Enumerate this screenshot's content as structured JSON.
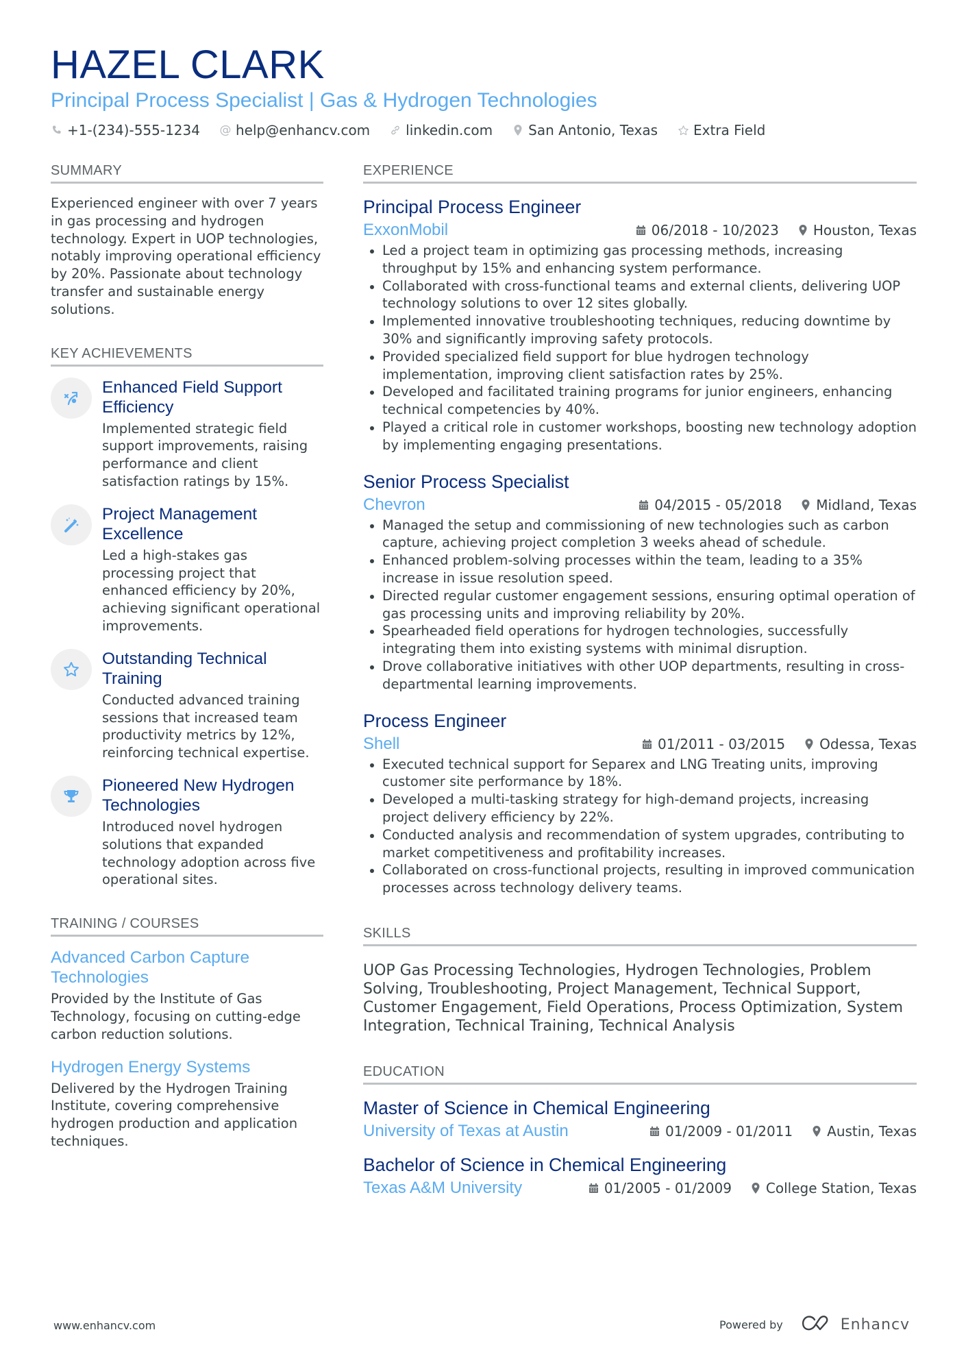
{
  "header": {
    "name": "HAZEL CLARK",
    "title": "Principal Process Specialist | Gas & Hydrogen Technologies",
    "contacts": [
      {
        "icon": "phone-icon",
        "text": "+1-(234)-555-1234"
      },
      {
        "icon": "at-icon",
        "text": "help@enhancv.com"
      },
      {
        "icon": "link-icon",
        "text": "linkedin.com"
      },
      {
        "icon": "location-icon",
        "text": "San Antonio, Texas"
      },
      {
        "icon": "star-icon",
        "text": "Extra Field"
      }
    ]
  },
  "summary": {
    "heading": "SUMMARY",
    "text": "Experienced engineer with over 7 years in gas processing and hydrogen technology. Expert in UOP technologies, notably improving operational efficiency by 20%. Passionate about technology transfer and sustainable energy solutions."
  },
  "achievements": {
    "heading": "KEY ACHIEVEMENTS",
    "items": [
      {
        "icon": "strategy-icon",
        "title": "Enhanced Field Support Efficiency",
        "description": "Implemented strategic field support improvements, raising performance and client satisfaction ratings by 15%."
      },
      {
        "icon": "magic-wand-icon",
        "title": "Project Management Excellence",
        "description": "Led a high-stakes gas processing project that enhanced efficiency by 20%, achieving significant operational improvements."
      },
      {
        "icon": "star-icon",
        "title": "Outstanding Technical Training",
        "description": "Conducted advanced training sessions that increased team productivity metrics by 12%, reinforcing technical expertise."
      },
      {
        "icon": "trophy-icon",
        "title": "Pioneered New Hydrogen Technologies",
        "description": "Introduced novel hydrogen solutions that expanded technology adoption across five operational sites."
      }
    ]
  },
  "training": {
    "heading": "TRAINING / COURSES",
    "items": [
      {
        "title": "Advanced Carbon Capture Technologies",
        "description": "Provided by the Institute of Gas Technology, focusing on cutting-edge carbon reduction solutions."
      },
      {
        "title": "Hydrogen Energy Systems",
        "description": "Delivered by the Hydrogen Training Institute, covering comprehensive hydrogen production and application techniques."
      }
    ]
  },
  "experience": {
    "heading": "EXPERIENCE",
    "jobs": [
      {
        "title": "Principal Process Engineer",
        "company": "ExxonMobil",
        "dates": "06/2018 - 10/2023",
        "location": "Houston, Texas",
        "bullets": [
          "Led a project team in optimizing gas processing methods, increasing throughput by 15% and enhancing system performance.",
          "Collaborated with cross-functional teams and external clients, delivering UOP technology solutions to over 12 sites globally.",
          "Implemented innovative troubleshooting techniques, reducing downtime by 30% and significantly improving safety protocols.",
          "Provided specialized field support for blue hydrogen technology implementation, improving client satisfaction rates by 25%.",
          "Developed and facilitated training programs for junior engineers, enhancing technical competencies by 40%.",
          "Played a critical role in customer workshops, boosting new technology adoption by implementing engaging presentations."
        ]
      },
      {
        "title": "Senior Process Specialist",
        "company": "Chevron",
        "dates": "04/2015 - 05/2018",
        "location": "Midland, Texas",
        "bullets": [
          "Managed the setup and commissioning of new technologies such as carbon capture, achieving project completion 3 weeks ahead of schedule.",
          "Enhanced problem-solving processes within the team, leading to a 35% increase in issue resolution speed.",
          "Directed regular customer engagement sessions, ensuring optimal operation of gas processing units and improving reliability by 20%.",
          "Spearheaded field operations for hydrogen technologies, successfully integrating them into existing systems with minimal disruption.",
          "Drove collaborative initiatives with other UOP departments, resulting in cross-departmental learning improvements."
        ]
      },
      {
        "title": "Process Engineer",
        "company": "Shell",
        "dates": "01/2011 - 03/2015",
        "location": "Odessa, Texas",
        "bullets": [
          "Executed technical support for Separex and LNG Treating units, improving customer site performance by 18%.",
          "Developed a multi-tasking strategy for high-demand projects, increasing project delivery efficiency by 22%.",
          "Conducted analysis and recommendation of system upgrades, contributing to market competitiveness and profitability increases.",
          "Collaborated on cross-functional projects, resulting in improved communication processes across technology delivery teams."
        ]
      }
    ]
  },
  "skills": {
    "heading": "SKILLS",
    "text": "UOP Gas Processing Technologies, Hydrogen Technologies, Problem Solving, Troubleshooting, Project Management, Technical Support, Customer Engagement, Field Operations, Process Optimization, System Integration, Technical Training, Technical Analysis"
  },
  "education": {
    "heading": "EDUCATION",
    "items": [
      {
        "degree": "Master of Science in Chemical Engineering",
        "school": "University of Texas at Austin",
        "dates": "01/2009 - 01/2011",
        "location": "Austin, Texas"
      },
      {
        "degree": "Bachelor of Science in Chemical Engineering",
        "school": "Texas A&M University",
        "dates": "01/2005 - 01/2009",
        "location": "College Station, Texas"
      }
    ]
  },
  "footer": {
    "website": "www.enhancv.com",
    "powered_by": "Powered by",
    "brand": "Enhancv"
  },
  "colors": {
    "name": "#0a2d7d",
    "accent": "#5aabf0",
    "text": "#384347",
    "rule": "#bfc2c5"
  }
}
